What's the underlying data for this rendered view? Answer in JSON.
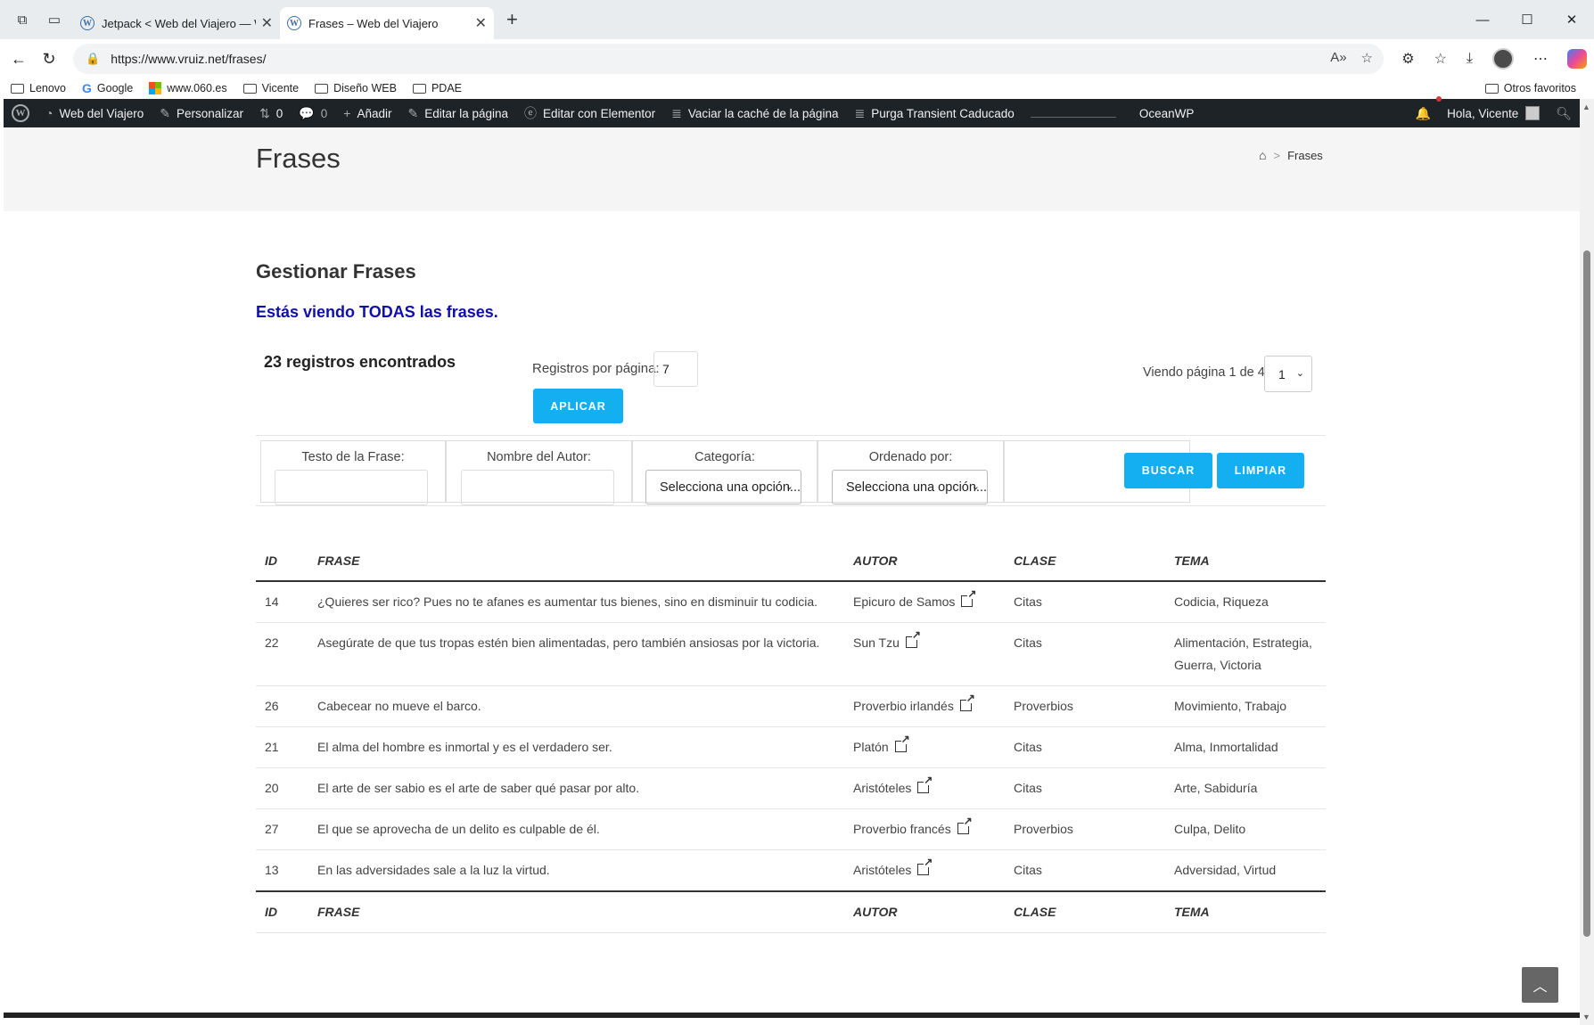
{
  "browser": {
    "tabs": [
      {
        "title": "Jetpack < Web del Viajero — Wo"
      },
      {
        "title": "Frases – Web del Viajero"
      }
    ],
    "url": "https://www.vruiz.net/frases/",
    "bookmarks": [
      "Lenovo",
      "Google",
      "www.060.es",
      "Vicente",
      "Diseño WEB",
      "PDAE"
    ],
    "other_bookmarks": "Otros favoritos"
  },
  "adminbar": {
    "site": "Web del Viajero",
    "customize": "Personalizar",
    "revisions": "0",
    "comments": "0",
    "add": "Añadir",
    "edit_page": "Editar la página",
    "elementor": "Editar con Elementor",
    "cache": "Vaciar la caché de la página",
    "transient": "Purga Transient Caducado",
    "theme": "OceanWP",
    "greeting": "Hola, Vicente"
  },
  "page": {
    "title": "Frases",
    "breadcrumb": "Frases",
    "heading": "Gestionar Frases",
    "notice": "Estás viendo TODAS las frases.",
    "records": "23 registros encontrados",
    "per_page_label": "Registros por página:",
    "per_page_value": "7",
    "apply": "APLICAR",
    "page_info": "Viendo página 1 de 4",
    "page_value": "1"
  },
  "filters": {
    "text_label": "Testo de la Frase:",
    "author_label": "Nombre del Autor:",
    "category_label": "Categoría:",
    "category_value": "Selecciona una opción...",
    "order_label": "Ordenado por:",
    "order_value": "Selecciona una opción...",
    "search": "BUSCAR",
    "clear": "LIMPIAR"
  },
  "table": {
    "headers": [
      "ID",
      "FRASE",
      "AUTOR",
      "CLASE",
      "TEMA"
    ],
    "rows": [
      {
        "id": "14",
        "frase": "¿Quieres ser rico? Pues no te afanes es aumentar tus bienes, sino en disminuir tu codicia.",
        "autor": "Epicuro de Samos",
        "clase": "Citas",
        "tema": "Codicia, Riqueza"
      },
      {
        "id": "22",
        "frase": "Asegúrate de que tus tropas estén bien alimentadas, pero también ansiosas por la victoria.",
        "autor": "Sun Tzu",
        "clase": "Citas",
        "tema": "Alimentación, Estrategia, Guerra, Victoria"
      },
      {
        "id": "26",
        "frase": "Cabecear no mueve el barco.",
        "autor": "Proverbio irlandés",
        "clase": "Proverbios",
        "tema": "Movimiento, Trabajo"
      },
      {
        "id": "21",
        "frase": "El alma del hombre es inmortal y es el verdadero ser.",
        "autor": "Platón",
        "clase": "Citas",
        "tema": "Alma, Inmortalidad"
      },
      {
        "id": "20",
        "frase": "El arte de ser sabio es el arte de saber qué pasar por alto.",
        "autor": "Aristóteles",
        "clase": "Citas",
        "tema": "Arte, Sabiduría"
      },
      {
        "id": "27",
        "frase": "El que se aprovecha de un delito es culpable de él.",
        "autor": "Proverbio francés",
        "clase": "Proverbios",
        "tema": "Culpa, Delito"
      },
      {
        "id": "13",
        "frase": "En las adversidades sale a la luz la virtud.",
        "autor": "Aristóteles",
        "clase": "Citas",
        "tema": "Adversidad, Virtud"
      }
    ]
  },
  "colors": {
    "accent": "#13aff0",
    "notice": "#1010a8",
    "adminbar": "#1d2327"
  }
}
